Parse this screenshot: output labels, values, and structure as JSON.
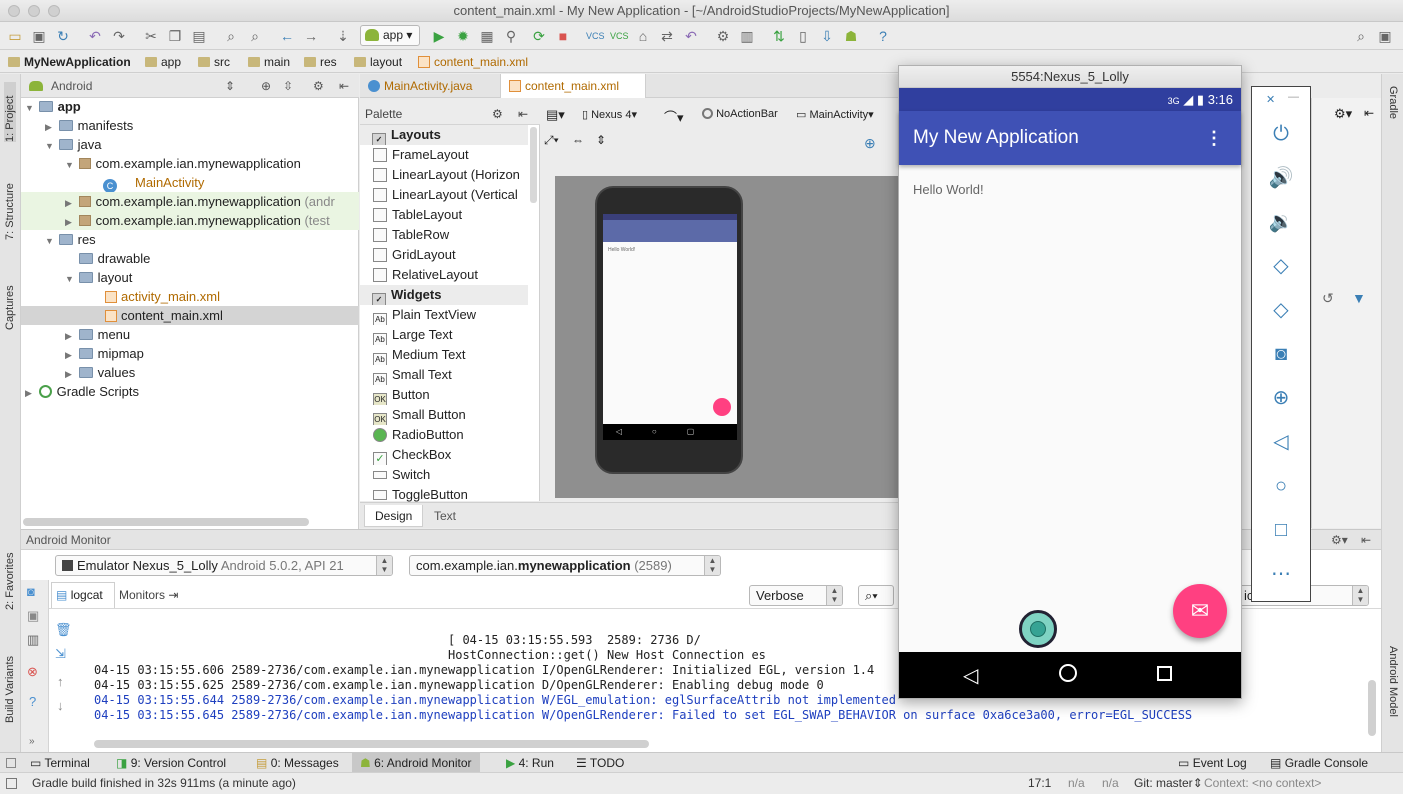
{
  "window": {
    "title": "content_main.xml - My New Application - [~/AndroidStudioProjects/MyNewApplication]"
  },
  "toolbar": {
    "run_config": "app",
    "help_icon": "?"
  },
  "breadcrumbs": [
    "MyNewApplication",
    "app",
    "src",
    "main",
    "res",
    "layout",
    "content_main.xml"
  ],
  "left_tool_windows": [
    "1: Project",
    "7: Structure",
    "Captures",
    "2: Favorites",
    "Build Variants"
  ],
  "right_tool_windows": [
    "Gradle",
    "Android Model"
  ],
  "project": {
    "view_mode": "Android",
    "tree": [
      {
        "label": "app",
        "bold": true
      },
      {
        "label": "manifests"
      },
      {
        "label": "java"
      },
      {
        "label": "com.example.ian.mynewapplication"
      },
      {
        "label": "MainActivity"
      },
      {
        "label": "com.example.ian.mynewapplication",
        "suffix": "(andr"
      },
      {
        "label": "com.example.ian.mynewapplication",
        "suffix": "(test"
      },
      {
        "label": "res"
      },
      {
        "label": "drawable"
      },
      {
        "label": "layout"
      },
      {
        "label": "activity_main.xml"
      },
      {
        "label": "content_main.xml"
      },
      {
        "label": "menu"
      },
      {
        "label": "mipmap"
      },
      {
        "label": "values"
      },
      {
        "label": "Gradle Scripts"
      }
    ]
  },
  "editor_tabs": [
    {
      "label": "MainActivity.java",
      "active": false
    },
    {
      "label": "content_main.xml",
      "active": true
    }
  ],
  "palette": {
    "title": "Palette",
    "items": [
      {
        "label": "Layouts",
        "category": true
      },
      {
        "label": "FrameLayout"
      },
      {
        "label": "LinearLayout (Horizon"
      },
      {
        "label": "LinearLayout (Vertical"
      },
      {
        "label": "TableLayout"
      },
      {
        "label": "TableRow"
      },
      {
        "label": "GridLayout"
      },
      {
        "label": "RelativeLayout"
      },
      {
        "label": "Widgets",
        "category": true
      },
      {
        "label": "Plain TextView"
      },
      {
        "label": "Large Text"
      },
      {
        "label": "Medium Text"
      },
      {
        "label": "Small Text"
      },
      {
        "label": "Button"
      },
      {
        "label": "Small Button"
      },
      {
        "label": "RadioButton"
      },
      {
        "label": "CheckBox"
      },
      {
        "label": "Switch"
      },
      {
        "label": "ToggleButton"
      }
    ]
  },
  "design_toolbar": {
    "device": "Nexus 4",
    "theme": "NoActionBar",
    "activity": "MainActivity"
  },
  "design_tabs": [
    "Design",
    "Text"
  ],
  "preview_text": "Hello World!",
  "android_monitor": {
    "title": "Android Monitor",
    "device_name": "Emulator Nexus_5_Lolly",
    "device_detail": "Android 5.0.2, API 21",
    "process_pkg_a": "com.example.ian.",
    "process_pkg_b": "mynewapplication",
    "process_pid": "(2589)",
    "tabs": [
      "logcat",
      "Monitors"
    ],
    "log_level": "Verbose",
    "right_combo": "ication",
    "log_lines": [
      {
        "text": "                                                 [ 04-15 03:15:55.593  2589: 2736 D/",
        "color": "#000000"
      },
      {
        "text": "                                                 HostConnection::get() New Host Connection es",
        "color": "#000000"
      },
      {
        "text": "04-15 03:15:55.606 2589-2736/com.example.ian.mynewapplication I/OpenGLRenderer: Initialized EGL, version 1.4",
        "color": "#000000"
      },
      {
        "text": "04-15 03:15:55.625 2589-2736/com.example.ian.mynewapplication D/OpenGLRenderer: Enabling debug mode 0",
        "color": "#000000"
      },
      {
        "text": "04-15 03:15:55.644 2589-2736/com.example.ian.mynewapplication W/EGL_emulation: eglSurfaceAttrib not implemented",
        "color": "#1e3fbf"
      },
      {
        "text": "04-15 03:15:55.645 2589-2736/com.example.ian.mynewapplication W/OpenGLRenderer: Failed to set EGL_SWAP_BEHAVIOR on surface 0xa6ce3a00, error=EGL_SUCCESS",
        "color": "#1e3fbf"
      }
    ]
  },
  "bottom_tabs": [
    {
      "label": "Terminal"
    },
    {
      "label": "9: Version Control"
    },
    {
      "label": "0: Messages"
    },
    {
      "label": "6: Android Monitor",
      "active": true
    },
    {
      "label": "4: Run"
    },
    {
      "label": "TODO"
    },
    {
      "label": "Event Log"
    },
    {
      "label": "Gradle Console"
    }
  ],
  "status": {
    "message": "Gradle build finished in 32s 911ms (a minute ago)",
    "position": "17:1",
    "na1": "n/a",
    "na2": "n/a",
    "git": "Git: master",
    "context": "Context: <no context>"
  },
  "emulator": {
    "window_title": "5554:Nexus_5_Lolly",
    "network": "3G",
    "time": "3:16",
    "app_title": "My New Application",
    "body_text": "Hello World!",
    "side_controls": [
      "power-icon",
      "volume-up-icon",
      "volume-down-icon",
      "rotate-left-icon",
      "rotate-right-icon",
      "camera-icon",
      "zoom-icon",
      "back-icon",
      "home-icon",
      "overview-icon",
      "more-icon"
    ]
  },
  "colors": {
    "primary": "#3f51b5",
    "primary_dark": "#303f9f",
    "accent": "#ff4081"
  }
}
